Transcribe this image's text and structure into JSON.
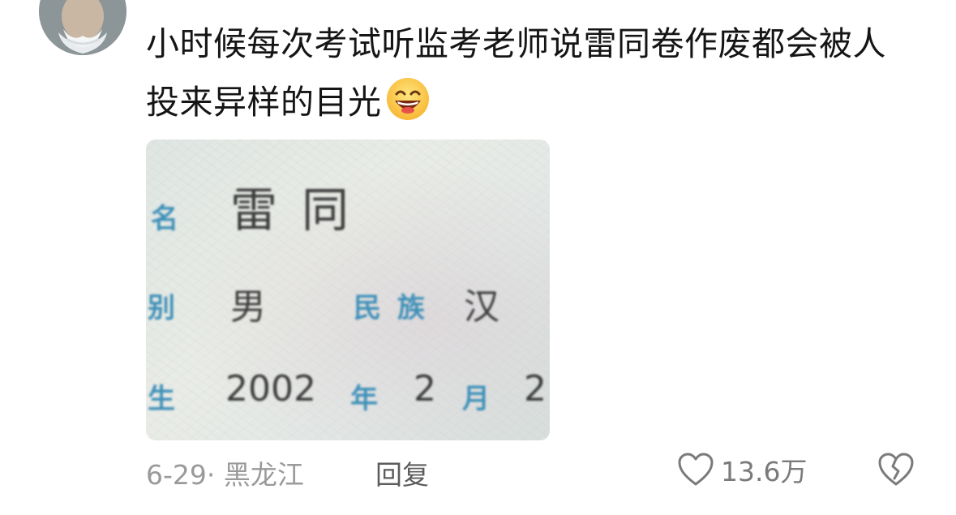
{
  "comment": {
    "text": "小时候每次考试听监考老师说雷同卷作废都会被人投来异样的目光",
    "emoji": "grinning-sweat-emoji",
    "photo": {
      "name_label": "名",
      "name_value": "雷同",
      "sex_label": "别",
      "sex_value": "男",
      "ethnic_label": "民 族",
      "ethnic_value": "汉",
      "birth_label": "生",
      "birth_year": "2002",
      "year_label": "年",
      "birth_month": "2",
      "month_label": "月",
      "birth_day_partial": "2"
    }
  },
  "footer": {
    "date_location": "6-29· 黑龙江",
    "reply_label": "回复",
    "like_count": "13.6万"
  },
  "colors": {
    "meta_text": "#9a9a9a",
    "reply_text": "#5c5c5c",
    "card_label": "#3f90b8"
  }
}
